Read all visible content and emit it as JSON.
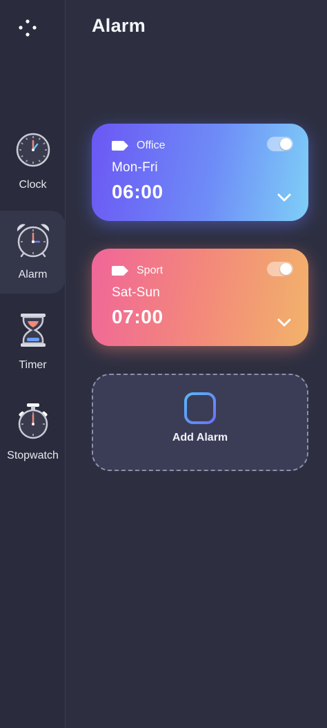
{
  "sidebar": {
    "items": [
      {
        "label": "Clock",
        "icon": "clock-icon"
      },
      {
        "label": "Alarm",
        "icon": "alarm-clock-icon"
      },
      {
        "label": "Timer",
        "icon": "hourglass-icon"
      },
      {
        "label": "Stopwatch",
        "icon": "stopwatch-icon"
      }
    ],
    "active": "Alarm"
  },
  "header": {
    "title": "Alarm"
  },
  "alarms": [
    {
      "tag": "Office",
      "days": "Mon-Fri",
      "time": "06:00",
      "enabled": true,
      "accent": "#6b57f4"
    },
    {
      "tag": "Sport",
      "days": "Sat-Sun",
      "time": "07:00",
      "enabled": true,
      "accent": "#f06699"
    }
  ],
  "add_alarm": {
    "label": "Add Alarm",
    "icon": "plus-icon"
  },
  "colors": {
    "background": "#2d2f41",
    "sidebar": "#2a2c3d",
    "add_card": "#3b3d57"
  }
}
